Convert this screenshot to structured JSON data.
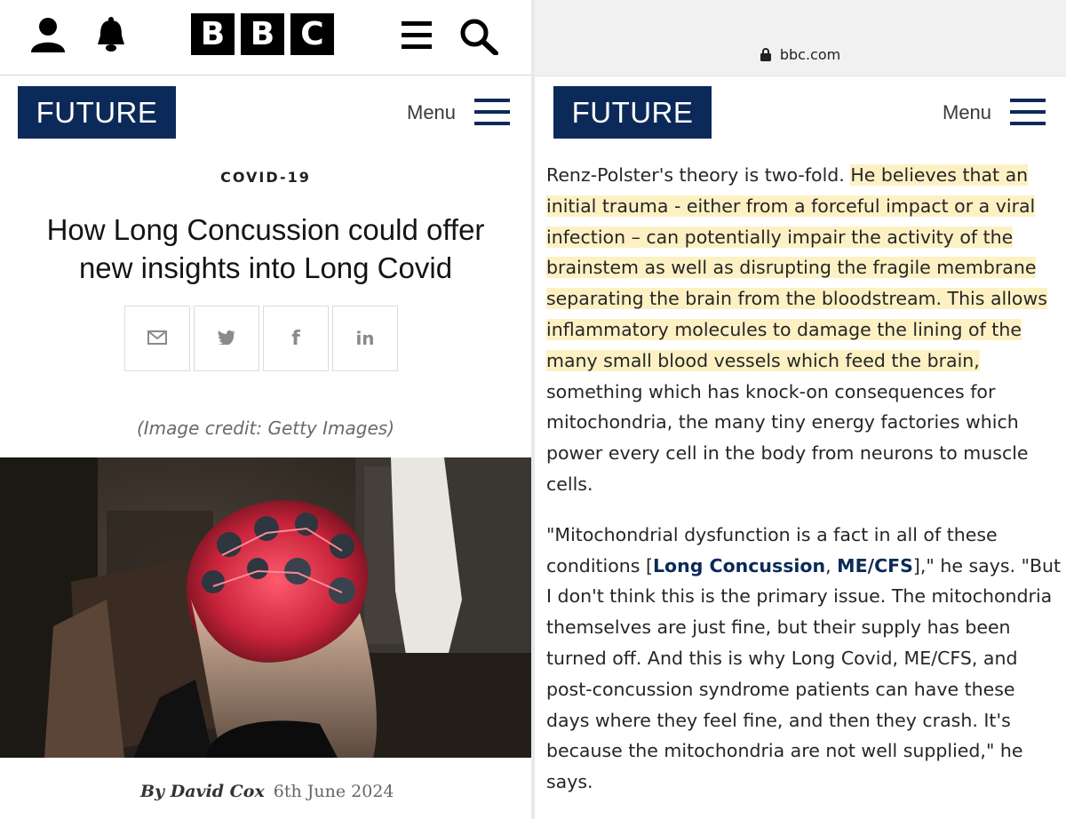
{
  "left": {
    "brand_letters": [
      "B",
      "B",
      "C"
    ],
    "section": "FUTURE",
    "menu_label": "Menu",
    "kicker": "COVID-19",
    "headline": "How Long Concussion could offer new insights into Long Covid",
    "share_buttons": [
      {
        "name": "email",
        "glyph": "✉"
      },
      {
        "name": "twitter",
        "glyph": "🐦"
      },
      {
        "name": "facebook",
        "glyph": "f"
      },
      {
        "name": "linkedin",
        "glyph": "in"
      }
    ],
    "image_credit": "(Image credit: Getty Images)",
    "byline": "By David Cox",
    "date": "6th June 2024"
  },
  "right": {
    "url": "bbc.com",
    "section": "FUTURE",
    "menu_label": "Menu",
    "p1_plain": "Renz-Polster's theory is two-fold. ",
    "p1_highlight": "He believes that an initial trauma - either from a forceful impact or a viral infection – can potentially impair the activity of the brainstem as well as disrupting the fragile membrane separating the brain from the bloodstream. This allows inflammatory molecules to damage the lining of the many small blood vessels which feed the brain,",
    "p1_rest": " something which has knock-on consequences for mitochondria, the many tiny energy factories which power every cell in the body from neurons to muscle cells.",
    "p2_start": "\"Mitochondrial dysfunction is a fact in all of these conditions [",
    "p2_link1": "Long Concussion",
    "p2_sep": ", ",
    "p2_link2": "ME/CFS",
    "p2_mid": "],\"",
    "p2_rest": " he says. \"But I don't think this is the primary issue. The mitochondria themselves are just fine, but their supply has been turned off. And this is why Long Covid, ME/CFS, and post-concussion syndrome patients can have these days where they feel fine, and then they crash. It's because the mitochondria are not well supplied,\" he says."
  },
  "colors": {
    "brand_navy": "#0b2a59",
    "highlight": "#fdf1c4"
  }
}
